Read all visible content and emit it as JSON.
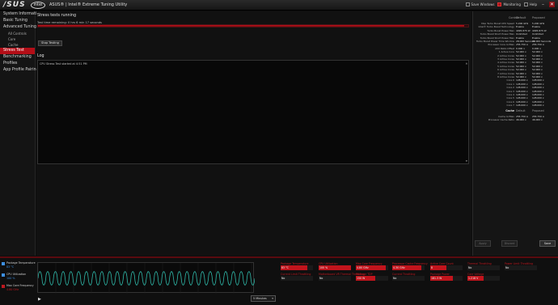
{
  "titlebar": {
    "brand": "/SUS",
    "intel": "intel",
    "title": "ASUS® | Intel® Extreme Tuning Utility",
    "toggles": [
      {
        "label": "Save Windows",
        "on": false
      },
      {
        "label": "Monitoring",
        "on": true
      },
      {
        "label": "Help",
        "on": false
      }
    ],
    "minimize": "–",
    "close": "✕"
  },
  "sidebar": {
    "items": [
      {
        "label": "System Information",
        "type": "item"
      },
      {
        "label": "Basic Tuning",
        "type": "item"
      },
      {
        "label": "Advanced Tuning",
        "type": "item"
      },
      {
        "label": "All Controls",
        "type": "sub"
      },
      {
        "label": "Core",
        "type": "sub"
      },
      {
        "label": "Cache",
        "type": "sub"
      },
      {
        "label": "Stress Test",
        "type": "item",
        "active": true
      },
      {
        "label": "Benchmarking",
        "type": "item"
      },
      {
        "label": "Profiles",
        "type": "item"
      },
      {
        "label": "App Profile Pairing",
        "type": "item"
      }
    ]
  },
  "center": {
    "status_label": "Stress tests running",
    "status_message": "Test time remaining: 0 hrs 6 min 17 seconds",
    "progress": 0.99,
    "stop_button": "Stop Testing",
    "log_label": "Log",
    "log_lines": [
      "CPU Stress Test started at 4:51 PM"
    ],
    "scroll_up": "▲",
    "scroll_down": "▼"
  },
  "right_panel": {
    "col_headers": [
      "Control",
      "Default",
      "Proposed"
    ],
    "rows": [
      {
        "label": "Max Turbo Boost CPU Speed",
        "v1": "5.200 GHz",
        "v2": "5.200 GHz"
      },
      {
        "label": "Intel® Turbo Boost Technology",
        "v1": "Enable",
        "v2": "Enable"
      },
      {
        "label": "Turbo Boost Power Max",
        "v1": "4095.875 W",
        "v2": "4095.875 W"
      },
      {
        "label": "Turbo Boost Short Power Max",
        "v1": "Unlimited",
        "v2": "Unlimited"
      },
      {
        "label": "Turbo Boost Short Power Max",
        "v1": "Enable",
        "v2": "Enable"
      },
      {
        "label": "Turbo Boost Power Time Window",
        "v1": "28.000 Seconds",
        "v2": "28.000 Seconds"
      },
      {
        "label": "Processor Core IccMax",
        "v1": "255.750 A",
        "v2": "255.750 A"
      },
      {
        "label": "AVX Ratio Offset",
        "v1": "0.000 x",
        "v2": "0.000 x"
      },
      {
        "label": "1 Active Core",
        "v1": "52.000 x",
        "v2": "52.000 x"
      },
      {
        "label": "2 Active Cores",
        "v1": "52.000 x",
        "v2": "52.000 x"
      },
      {
        "label": "3 Active Cores",
        "v1": "52.000 x",
        "v2": "52.000 x"
      },
      {
        "label": "4 Active Cores",
        "v1": "52.000 x",
        "v2": "52.000 x"
      },
      {
        "label": "5 Active Cores",
        "v1": "52.000 x",
        "v2": "52.000 x"
      },
      {
        "label": "6 Active Cores",
        "v1": "52.000 x",
        "v2": "52.000 x"
      },
      {
        "label": "7 Active Cores",
        "v1": "52.000 x",
        "v2": "52.000 x"
      },
      {
        "label": "8 Active Cores",
        "v1": "52.000 x",
        "v2": "52.000 x"
      },
      {
        "label": "Core 0",
        "v1": "128.000 x",
        "v2": "128.000 x"
      },
      {
        "label": "Core 1",
        "v1": "128.000 x",
        "v2": "128.000 x"
      },
      {
        "label": "Core 2",
        "v1": "128.000 x",
        "v2": "128.000 x"
      },
      {
        "label": "Core 3",
        "v1": "128.000 x",
        "v2": "128.000 x"
      },
      {
        "label": "Core 4",
        "v1": "128.000 x",
        "v2": "128.000 x"
      },
      {
        "label": "Core 5",
        "v1": "128.000 x",
        "v2": "128.000 x"
      },
      {
        "label": "Core 6",
        "v1": "128.000 x",
        "v2": "128.000 x"
      },
      {
        "label": "Core 7",
        "v1": "128.000 x",
        "v2": "128.000 x"
      }
    ],
    "cache_section": {
      "label": "Cache",
      "v1": "Default",
      "v2": "Proposed"
    },
    "cache_rows": [
      {
        "label": "Cache IccMax",
        "v1": "255.750 A",
        "v2": "255.750 A"
      },
      {
        "label": "Processor Cache Ratio",
        "v1": "46.000 x",
        "v2": "46.000 x"
      }
    ],
    "buttons": {
      "apply": "Apply",
      "discard": "Discard",
      "save": "Save"
    }
  },
  "monitor": {
    "legend": [
      {
        "name": "Package Temperature",
        "value": "83 °C",
        "color": "#3d8fe0",
        "checked": true
      },
      {
        "name": "CPU Utilization",
        "value": "100 %",
        "color": "#3d8fe0",
        "checked": true
      },
      {
        "name": "Max Core Frequency",
        "value": "4.80 GHz",
        "color": "#c0181f",
        "checked": true
      }
    ],
    "play": "▶",
    "interval": {
      "value": "5 Minutes",
      "arrow": "▾"
    },
    "graph_series": {
      "color": "#2fb7a8",
      "mean": 0.5,
      "amplitude": 0.22,
      "cycles": 28
    },
    "metrics": [
      {
        "label": "Package Temperature",
        "value": "83 °C",
        "fill": 0.83
      },
      {
        "label": "CPU Utilization",
        "value": "100 %",
        "fill": 1.0
      },
      {
        "label": "Max Core Frequency",
        "value": "4.80 GHz",
        "fill": 0.92
      },
      {
        "label": "Processor Cache Frequency",
        "value": "4.30 GHz",
        "fill": 0.9
      },
      {
        "label": "Active Core Count",
        "value": "8",
        "fill": 0.5
      },
      {
        "label": "Thermal Throttling",
        "value": "No",
        "fill": 0.0
      },
      {
        "label": "Power Limit Throttling",
        "value": "No",
        "fill": 0.0
      },
      {
        "label": "Current Limit Throttling",
        "value": "No",
        "fill": 0.0
      },
      {
        "label": "Motherboard VR Thermal Throttling",
        "value": "No",
        "fill": 0.0
      },
      {
        "label": "Package TDP",
        "value": "150 W",
        "fill": 0.6
      },
      {
        "label": "Current Throttling",
        "value": "No",
        "fill": 0.0
      },
      {
        "label": "Package Power",
        "value": "181.3 W",
        "fill": 0.7
      },
      {
        "label": "Core Voltage",
        "value": "1.218 V",
        "fill": 0.5
      }
    ]
  }
}
